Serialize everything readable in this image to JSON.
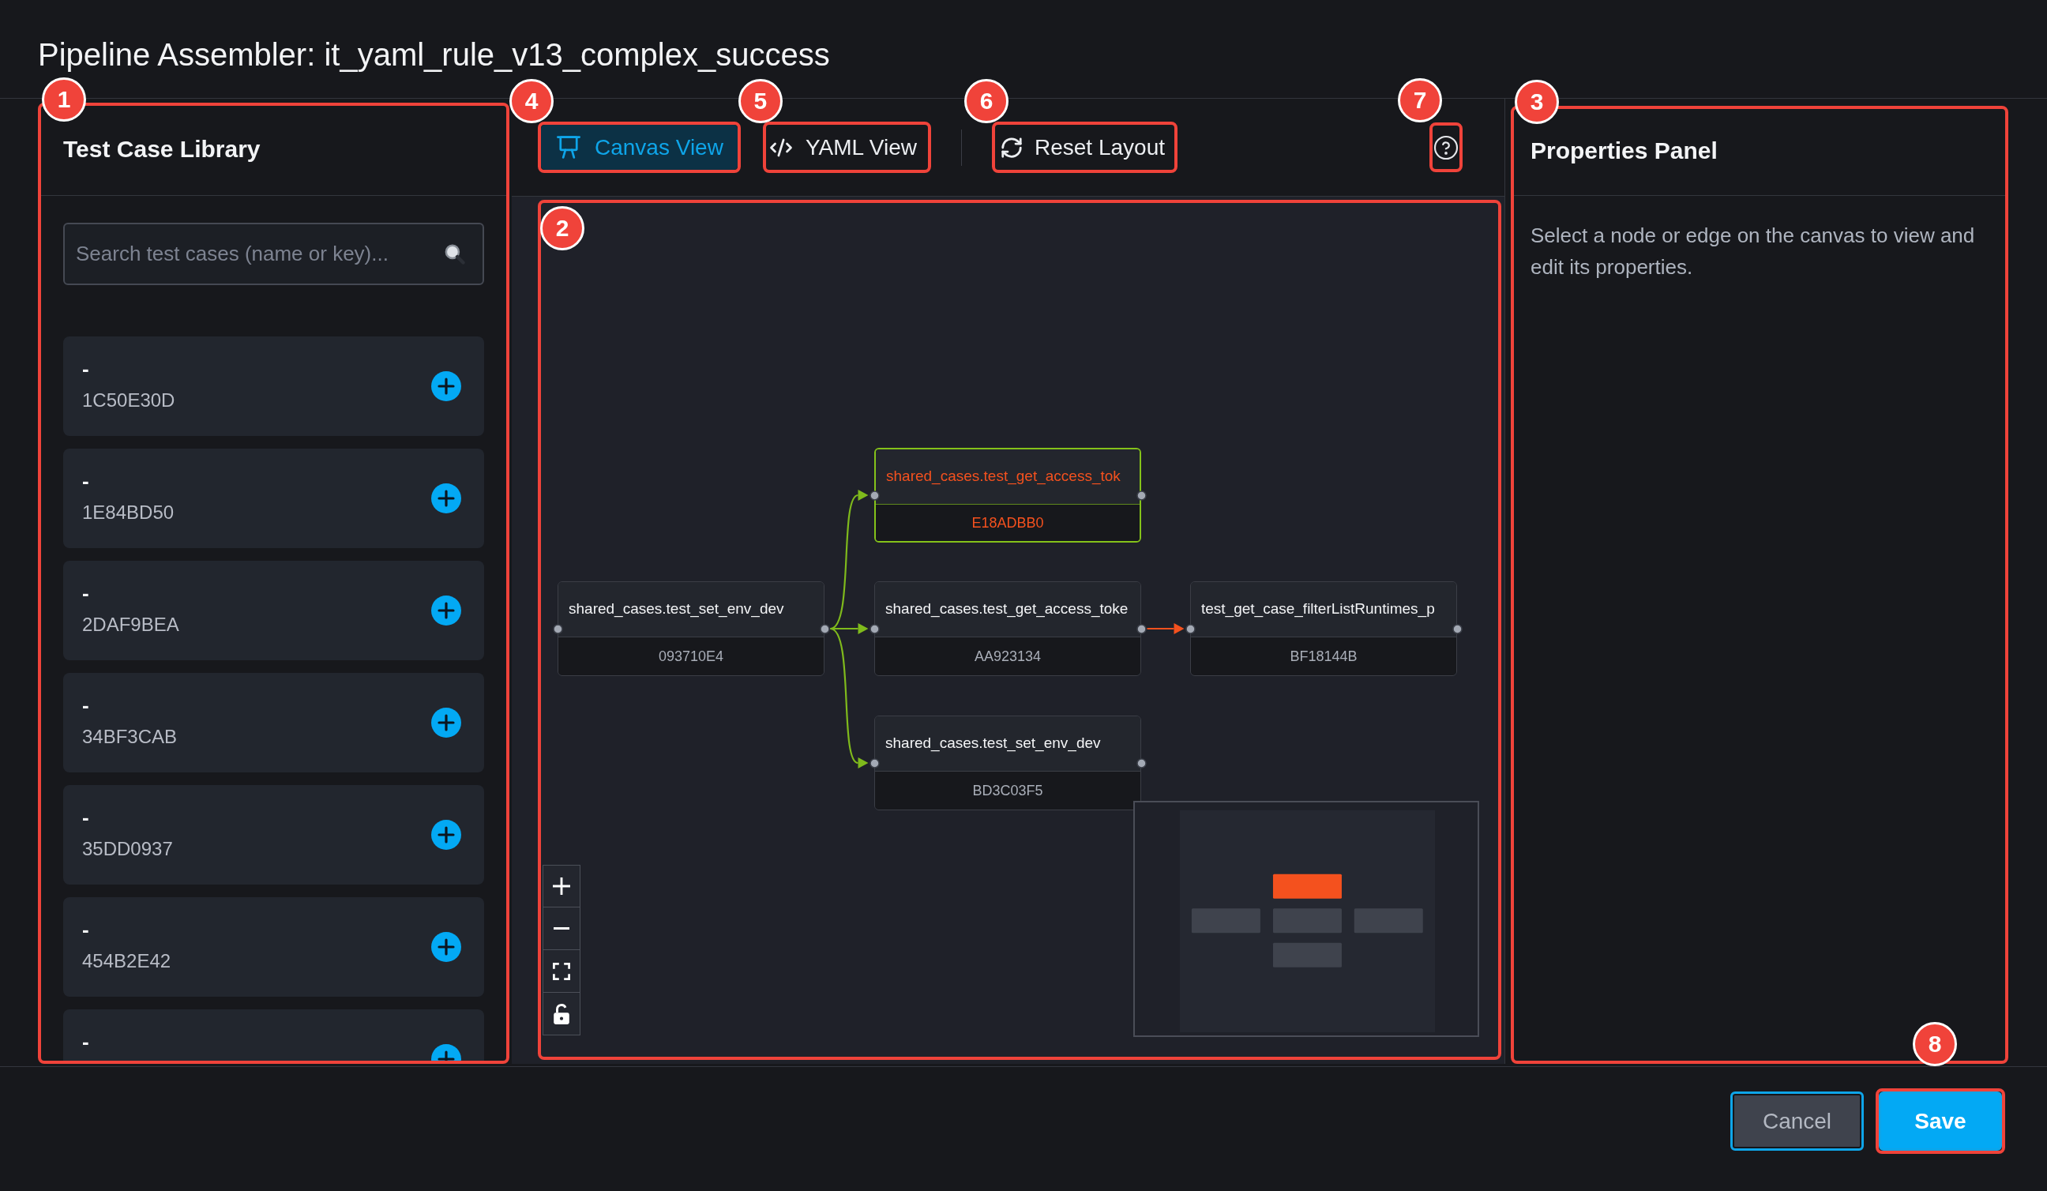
{
  "window": {
    "title": "Pipeline Assembler: it_yaml_rule_v13_complex_success"
  },
  "library": {
    "marker": "1",
    "title": "Test Case Library",
    "search": {
      "placeholder": "Search test cases (name or key)..."
    },
    "items": [
      {
        "name": "-",
        "key": "1C50E30D"
      },
      {
        "name": "-",
        "key": "1E84BD50"
      },
      {
        "name": "-",
        "key": "2DAF9BEA"
      },
      {
        "name": "-",
        "key": "34BF3CAB"
      },
      {
        "name": "-",
        "key": "35DD0937"
      },
      {
        "name": "-",
        "key": "454B2E42"
      },
      {
        "name": "-"
      }
    ]
  },
  "toolbar": {
    "tabs": [
      {
        "label": "Canvas View",
        "kind": "canvas",
        "selected": true,
        "marker": "4"
      },
      {
        "label": "YAML View",
        "kind": "code",
        "selected": false,
        "marker": "5"
      }
    ],
    "reset_button": {
      "label": "Reset Layout",
      "marker": "6"
    },
    "help_button": {
      "marker": "7"
    }
  },
  "canvas": {
    "marker": "2",
    "nodes": [
      {
        "title": "shared_cases.test_set_env_dev",
        "key": "093710E4",
        "highlighted": false
      },
      {
        "title": "shared_cases.test_get_access_tok",
        "key": "E18ADBB0",
        "highlighted": true
      },
      {
        "title": "shared_cases.test_get_access_toke",
        "key": "AA923134",
        "highlighted": false
      },
      {
        "title": "test_get_case_filterListRuntimes_p",
        "key": "BF18144B",
        "highlighted": false
      },
      {
        "title": "shared_cases.test_set_env_dev",
        "key": "BD3C03F5",
        "highlighted": false
      }
    ],
    "edges": [
      {
        "color": "#7fba1c"
      },
      {
        "color": "#7fba1c"
      },
      {
        "color": "#7fba1c"
      },
      {
        "color": "#f4511e"
      }
    ]
  },
  "properties": {
    "marker": "3",
    "title": "Properties Panel",
    "message": "Select a node or edge on the canvas to view and edit its properties."
  },
  "footer": {
    "buttons": [
      {
        "label": "Cancel",
        "kind": "secondary"
      },
      {
        "label": "Save",
        "kind": "primary",
        "marker": "8"
      }
    ]
  }
}
